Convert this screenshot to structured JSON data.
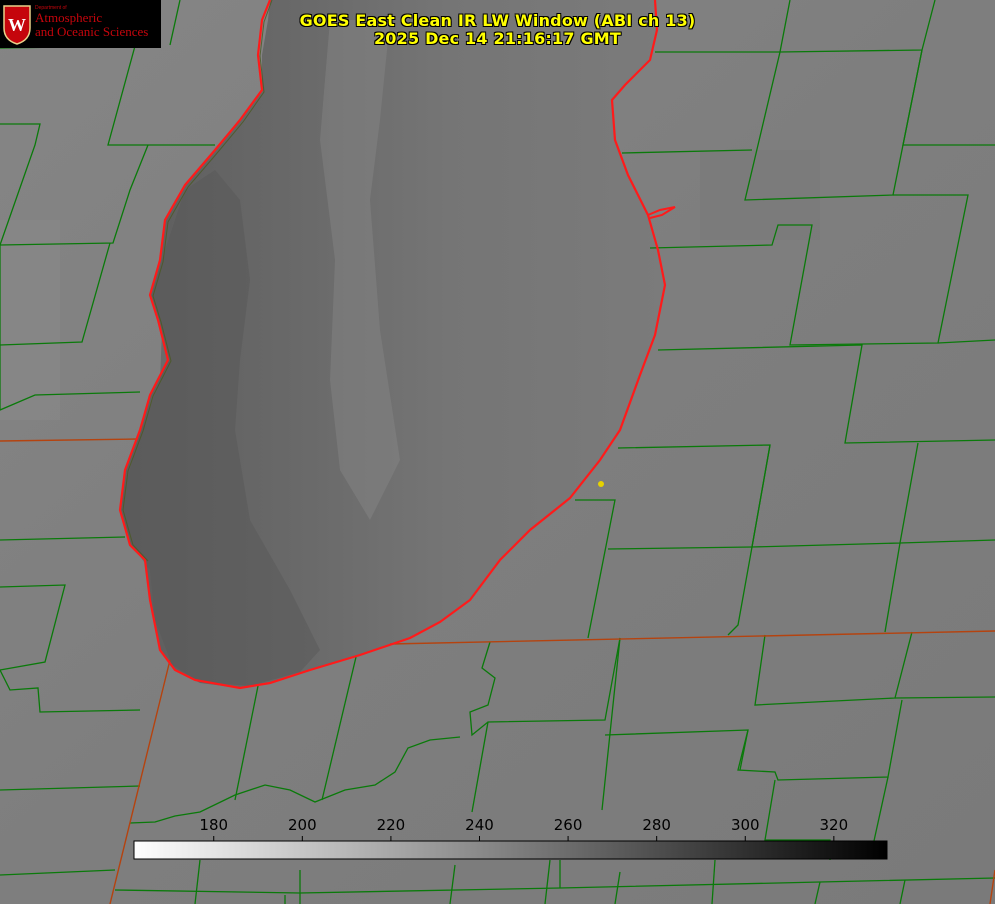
{
  "header": {
    "title_line1": "GOES East Clean IR LW Window (ABI ch 13)",
    "title_line2": "2025 Dec 14 21:16:17 GMT"
  },
  "logo": {
    "department": "Department of",
    "line1": "Atmospheric",
    "line2": "and Oceanic Sciences",
    "badge_letter": "W"
  },
  "colorbar": {
    "ticks": [
      "180",
      "200",
      "220",
      "240",
      "260",
      "280",
      "300",
      "320"
    ],
    "tick_values": [
      180,
      200,
      220,
      240,
      260,
      280,
      300,
      320
    ],
    "range": [
      162,
      332
    ],
    "gradient_start": "#ffffff",
    "gradient_end": "#000000"
  },
  "colors": {
    "title": "#ffff00",
    "coastline": "#ff1a1a",
    "county_lines": "#0a7a0a",
    "state_lines": "#b5430f",
    "marker": "#e6d200",
    "logo_red": "#c5050c"
  }
}
